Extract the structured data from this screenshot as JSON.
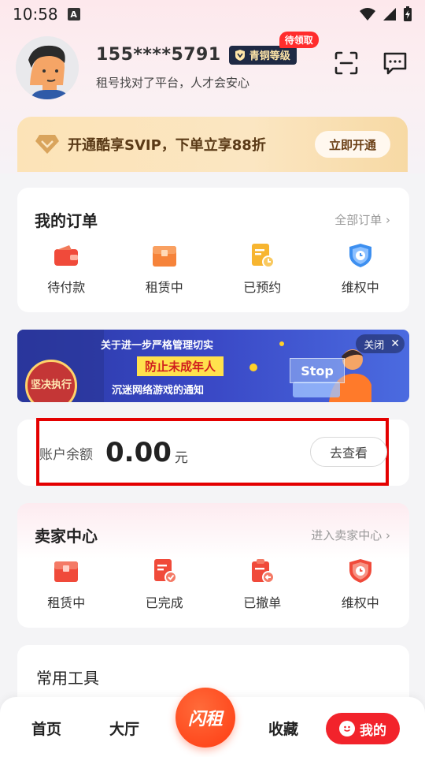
{
  "status_bar": {
    "time": "10:58",
    "notif_letter": "A"
  },
  "profile": {
    "phone": "155****5791",
    "level_badge": "青铜等级",
    "pending_tag": "待领取",
    "slogan": "租号找对了平台，人才会安心"
  },
  "svip": {
    "text": "开通酷享SVIP，下单立享88折",
    "button": "立即开通"
  },
  "orders": {
    "title": "我的订单",
    "more": "全部订单 ›",
    "items": [
      {
        "label": "待付款",
        "icon": "wallet-icon"
      },
      {
        "label": "租赁中",
        "icon": "box-icon"
      },
      {
        "label": "已预约",
        "icon": "calendar-doc-icon"
      },
      {
        "label": "维权中",
        "icon": "shield-icon"
      }
    ]
  },
  "banner": {
    "line1": "关于进一步严格管理切实",
    "line2": "防止未成年人",
    "line3": "沉迷网络游戏的通知",
    "stamp": "坚决执行",
    "stop": "Stop",
    "close": "关闭"
  },
  "balance": {
    "label": "账户余额",
    "value": "0.00",
    "unit": "元",
    "button": "去查看"
  },
  "seller": {
    "title": "卖家中心",
    "more": "进入卖家中心 ›",
    "items": [
      {
        "label": "租赁中",
        "icon": "box-icon"
      },
      {
        "label": "已完成",
        "icon": "doc-check-icon"
      },
      {
        "label": "已撤单",
        "icon": "clipboard-back-icon"
      },
      {
        "label": "维权中",
        "icon": "shield-icon"
      }
    ]
  },
  "tools": {
    "title": "常用工具"
  },
  "bottom_nav": {
    "home": "首页",
    "hall": "大厅",
    "center": "闪租",
    "favorites": "收藏",
    "mine": "我的"
  },
  "colors": {
    "accent_red": "#f2232b",
    "highlight_box": "#e40000",
    "svip_gold": "#fce3b7"
  }
}
